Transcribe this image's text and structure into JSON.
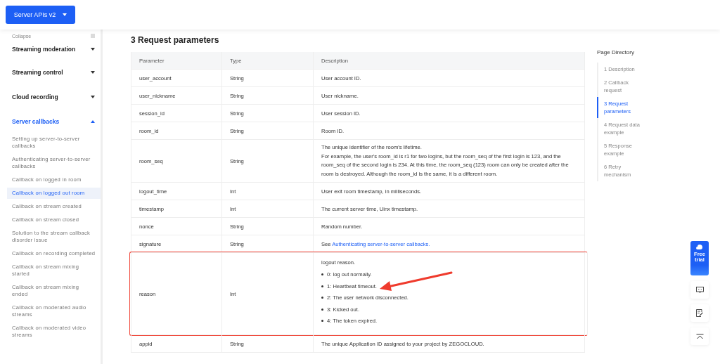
{
  "product_button": {
    "label": "Server APIs v2"
  },
  "sidebar": {
    "collapse_label": "Collapse",
    "sections": [
      {
        "label": "Streaming moderation",
        "expanded": false
      },
      {
        "label": "Streaming control",
        "expanded": false
      },
      {
        "label": "Cloud recording",
        "expanded": false
      },
      {
        "label": "Server callbacks",
        "expanded": true,
        "children": [
          {
            "label": "Setting up server-to-server callbacks",
            "selected": false
          },
          {
            "label": "Authenticating server-to-server callbacks",
            "selected": false
          },
          {
            "label": "Callback on logged in room",
            "selected": false
          },
          {
            "label": "Callback on logged out room",
            "selected": true
          },
          {
            "label": "Callback on stream created",
            "selected": false
          },
          {
            "label": "Callback on stream closed",
            "selected": false
          },
          {
            "label": "Solution to the stream callback disorder issue",
            "selected": false
          },
          {
            "label": "Callback on recording completed",
            "selected": false
          },
          {
            "label": "Callback on stream mixing started",
            "selected": false
          },
          {
            "label": "Callback on stream mixing ended",
            "selected": false
          },
          {
            "label": "Callback on moderated audio streams",
            "selected": false
          },
          {
            "label": "Callback on moderated video streams",
            "selected": false
          }
        ]
      }
    ]
  },
  "section_title": "3 Request parameters",
  "table": {
    "columns": [
      "Parameter",
      "Type",
      "Description"
    ],
    "rows": [
      {
        "parameter": "user_account",
        "type": "String",
        "kind": "text",
        "lines": [
          "User account ID."
        ],
        "highlighted": false
      },
      {
        "parameter": "user_nickname",
        "type": "String",
        "kind": "text",
        "lines": [
          "User nickname."
        ],
        "highlighted": false
      },
      {
        "parameter": "session_id",
        "type": "String",
        "kind": "text",
        "lines": [
          "User session ID."
        ],
        "highlighted": false
      },
      {
        "parameter": "room_id",
        "type": "String",
        "kind": "text",
        "lines": [
          "Room ID."
        ],
        "highlighted": false
      },
      {
        "parameter": "room_seq",
        "type": "String",
        "kind": "text",
        "lines": [
          "The unique identifier of the room's lifetime.",
          "For example, the user's room_id is r1 for two logins, but the room_seq of the first login is 123, and the room_seq of the second login is 234. At this time, the room_seq (123) room can only be created after the room is destroyed. Although the room_id is the same, it is a different room."
        ],
        "highlighted": false
      },
      {
        "parameter": "logout_time",
        "type": "Int",
        "kind": "text",
        "lines": [
          "User exit room timestamp, in milliseconds."
        ],
        "highlighted": false
      },
      {
        "parameter": "timestamp",
        "type": "Int",
        "kind": "text",
        "lines": [
          "The current server time, Uinx timestamp."
        ],
        "highlighted": false
      },
      {
        "parameter": "nonce",
        "type": "String",
        "kind": "text",
        "lines": [
          "Random number."
        ],
        "highlighted": false
      },
      {
        "parameter": "signature",
        "type": "String",
        "kind": "link",
        "prefix": "See",
        "link": "Authenticating server-to-server callbacks.",
        "highlighted": false
      },
      {
        "parameter": "reason",
        "type": "Int",
        "kind": "list",
        "intro": "logout reason.",
        "items": [
          "0: log out normally.",
          "1: Heartbeat timeout.",
          "2: The user network disconnected.",
          "3: Kicked out.",
          "4: The token expired."
        ],
        "highlighted": true
      },
      {
        "parameter": "appid",
        "type": "String",
        "kind": "text",
        "lines": [
          "The unique Application ID assigned to your project by ZEGOCLOUD."
        ],
        "highlighted": false
      }
    ]
  },
  "page_directory": {
    "title": "Page Directory",
    "items": [
      {
        "label": "1 Description",
        "selected": false
      },
      {
        "label": "2 Callback request",
        "selected": false
      },
      {
        "label": "3 Request parameters",
        "selected": true
      },
      {
        "label": "4 Request data example",
        "selected": false
      },
      {
        "label": "5 Response example",
        "selected": false
      },
      {
        "label": "6 Retry mechanism",
        "selected": false
      }
    ]
  },
  "free_trial": {
    "label": "Free trial"
  }
}
